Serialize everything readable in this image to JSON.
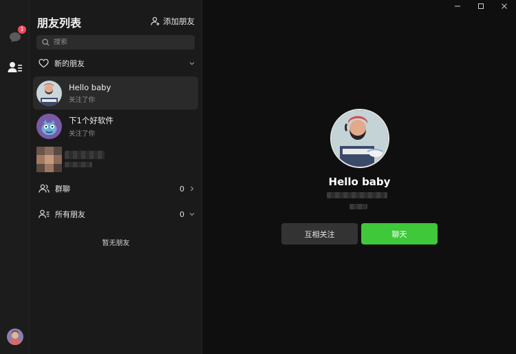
{
  "rail": {
    "chat_badge": "1"
  },
  "panel": {
    "title": "朋友列表",
    "add_friend_label": "添加朋友",
    "search_placeholder": "搜索",
    "new_friends_label": "新的朋友",
    "friends": [
      {
        "name": "Hello baby",
        "sub": "关注了你"
      },
      {
        "name": "下1个好软件",
        "sub": "关注了你"
      }
    ],
    "groups_label": "群聊",
    "groups_count": "0",
    "all_friends_label": "所有朋友",
    "all_friends_count": "0",
    "empty_note": "暂无朋友"
  },
  "profile": {
    "name": "Hello baby",
    "follow_label": "互相关注",
    "chat_label": "聊天"
  },
  "colors": {
    "accent": "#3ec83a",
    "badge": "#f04a5a"
  }
}
